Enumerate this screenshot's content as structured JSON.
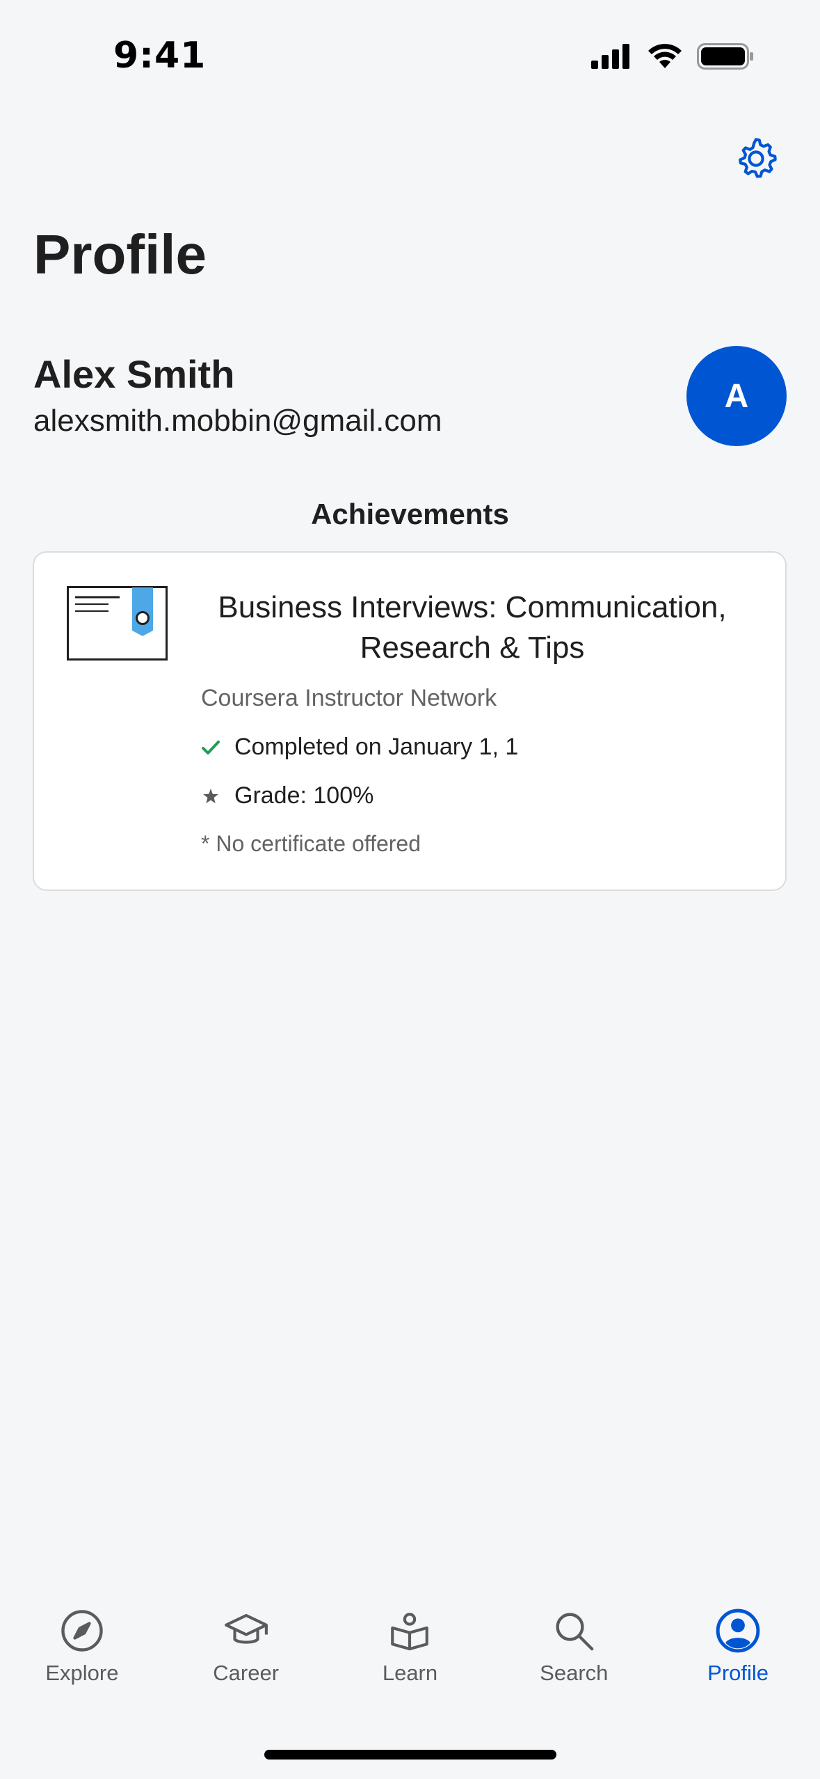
{
  "status_bar": {
    "time": "9:41"
  },
  "header": {
    "title": "Profile",
    "settings_icon": "gear-icon"
  },
  "user": {
    "name": "Alex Smith",
    "email": "alexsmith.mobbin@gmail.com",
    "avatar_initial": "A"
  },
  "achievements": {
    "section_title": "Achievements",
    "items": [
      {
        "course_title": "Business Interviews: Communication, Research & Tips",
        "provider": "Coursera Instructor Network",
        "completed_text": "Completed on January 1, 1",
        "grade_text": "Grade: 100%",
        "certificate_note": "* No certificate offered"
      }
    ]
  },
  "tab_bar": {
    "tabs": [
      {
        "label": "Explore",
        "icon": "compass-icon",
        "active": false
      },
      {
        "label": "Career",
        "icon": "graduation-cap-icon",
        "active": false
      },
      {
        "label": "Learn",
        "icon": "book-reader-icon",
        "active": false
      },
      {
        "label": "Search",
        "icon": "search-icon",
        "active": false
      },
      {
        "label": "Profile",
        "icon": "profile-icon",
        "active": true
      }
    ]
  },
  "colors": {
    "accent": "#0056d2",
    "background": "#f5f6f8",
    "success": "#1f9d55",
    "muted_text": "#636363"
  }
}
